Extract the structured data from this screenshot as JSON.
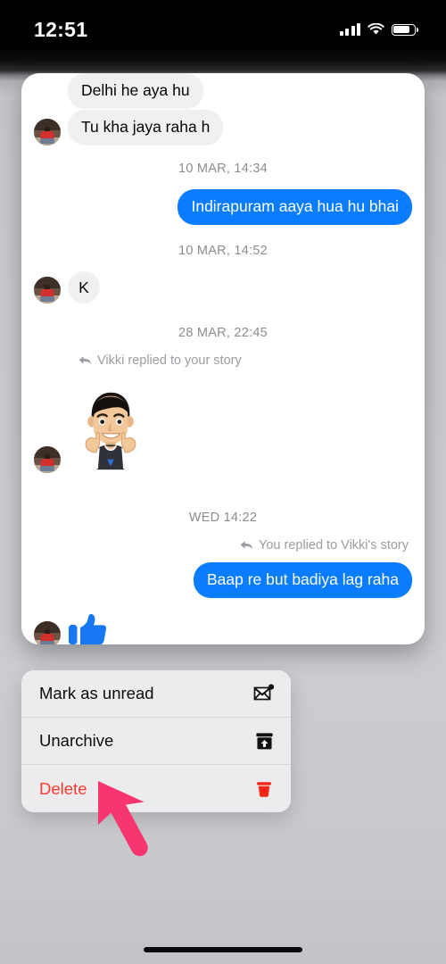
{
  "status_bar": {
    "time": "12:51",
    "icons": [
      "cellular-signal-icon",
      "wifi-icon",
      "battery-icon"
    ],
    "battery_level": "70"
  },
  "theme": {
    "bubble_incoming_bg": "#f0f0f0",
    "bubble_outgoing_bg": "#0a7cff",
    "text_primary": "#050505",
    "text_muted": "#8a8d91",
    "danger": "#ff3b30",
    "pointer": "#f7366f",
    "backdrop": "#c8cace",
    "card_bg": "#ffffff"
  },
  "chat": {
    "items": [
      {
        "kind": "bubble",
        "side": "left",
        "text": "Delhi he aya hu",
        "avatar": false
      },
      {
        "kind": "bubble",
        "side": "left",
        "text": "Tu kha jaya raha h",
        "avatar": true
      },
      {
        "kind": "separator",
        "text": "10 MAR, 14:34"
      },
      {
        "kind": "bubble",
        "side": "right",
        "text": "Indirapuram aaya hua hu bhai"
      },
      {
        "kind": "separator",
        "text": "10 MAR, 14:52"
      },
      {
        "kind": "bubble",
        "side": "left",
        "text": "K",
        "avatar": true
      },
      {
        "kind": "separator",
        "text": "28 MAR, 22:45"
      },
      {
        "kind": "story-note",
        "side": "left",
        "text": "Vikki replied to your story",
        "icon": "reply-arrow-icon"
      },
      {
        "kind": "sticker",
        "side": "left",
        "name": "avatar-thumbs-up-sticker",
        "avatar": true
      },
      {
        "kind": "separator",
        "text": "WED 14:22"
      },
      {
        "kind": "story-note",
        "side": "right",
        "text": "You replied to Vikki's story",
        "icon": "reply-arrow-icon"
      },
      {
        "kind": "bubble",
        "side": "right",
        "text": "Baap re but badiya lag raha"
      },
      {
        "kind": "reaction",
        "side": "left",
        "name": "thumbs-up-reaction",
        "avatar": true
      },
      {
        "kind": "seen",
        "side": "right",
        "name": "seen-avatar"
      }
    ]
  },
  "context_menu": {
    "items": [
      {
        "label": "Mark as unread",
        "icon": "mail-unread-icon",
        "danger": false
      },
      {
        "label": "Unarchive",
        "icon": "unarchive-icon",
        "danger": false
      },
      {
        "label": "Delete",
        "icon": "trash-icon",
        "danger": true
      }
    ]
  },
  "pointer": {
    "name": "arrow-pointer",
    "target": "Delete"
  }
}
